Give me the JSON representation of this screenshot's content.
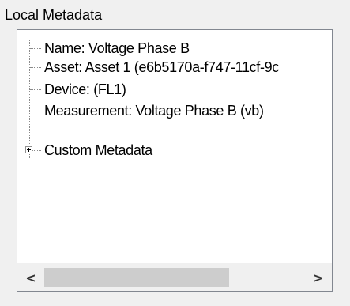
{
  "group": {
    "title": "Local Metadata"
  },
  "tree": {
    "items": [
      {
        "label": "Name: Voltage Phase B",
        "expandable": false
      },
      {
        "label": "Asset: Asset 1 (e6b5170a-f747-11cf-9c",
        "expandable": false
      },
      {
        "label": "Device: (FL1)",
        "expandable": false
      },
      {
        "label": "Measurement: Voltage Phase B (vb)",
        "expandable": false
      },
      {
        "label": "Custom Metadata",
        "expandable": true,
        "expanded": false
      }
    ]
  },
  "scrollbar": {
    "left_arrow": "<",
    "right_arrow": ">",
    "thumb_fraction": 0.71
  }
}
